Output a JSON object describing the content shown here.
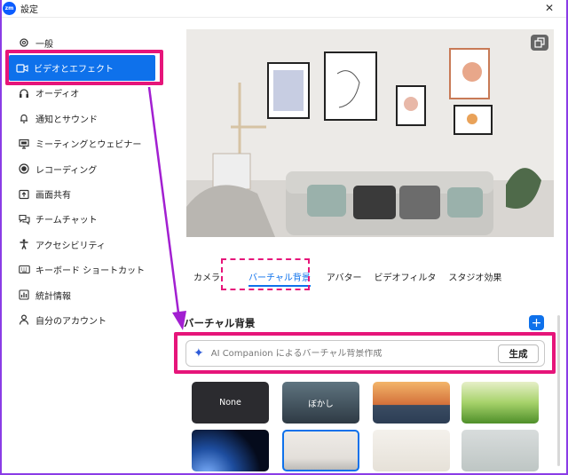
{
  "window": {
    "title": "設定",
    "app_logo": "zm",
    "close": "✕"
  },
  "sidebar": {
    "items": [
      {
        "label": "一般",
        "icon": "gear-icon"
      },
      {
        "label": "ビデオとエフェクト",
        "icon": "video-camera-icon"
      },
      {
        "label": "オーディオ",
        "icon": "headphones-icon"
      },
      {
        "label": "通知とサウンド",
        "icon": "bell-icon"
      },
      {
        "label": "ミーティングとウェビナー",
        "icon": "monitor-icon"
      },
      {
        "label": "レコーディング",
        "icon": "record-icon"
      },
      {
        "label": "画面共有",
        "icon": "share-screen-icon"
      },
      {
        "label": "チームチャット",
        "icon": "chat-icon"
      },
      {
        "label": "アクセシビリティ",
        "icon": "accessibility-icon"
      },
      {
        "label": "キーボード ショートカット",
        "icon": "keyboard-icon"
      },
      {
        "label": "統計情報",
        "icon": "statistics-icon"
      },
      {
        "label": "自分のアカウント",
        "icon": "person-icon"
      }
    ],
    "active_index": 1
  },
  "tabs": [
    "カメラ",
    "バーチャル背景",
    "アバター",
    "ビデオフィルタ",
    "スタジオ効果"
  ],
  "active_tab_index": 1,
  "section": {
    "title": "バーチャル背景",
    "add_label": "+"
  },
  "ai": {
    "placeholder": "AI Companion によるバーチャル背景作成",
    "generate_label": "生成"
  },
  "thumbnails": [
    {
      "label": "None"
    },
    {
      "label": "ぼかし"
    },
    {
      "label": ""
    },
    {
      "label": ""
    },
    {
      "label": ""
    },
    {
      "label": ""
    },
    {
      "label": ""
    },
    {
      "label": ""
    }
  ],
  "colors": {
    "accent": "#0e71eb",
    "highlight": "#e6157a",
    "arrow": "#a21fd1"
  }
}
